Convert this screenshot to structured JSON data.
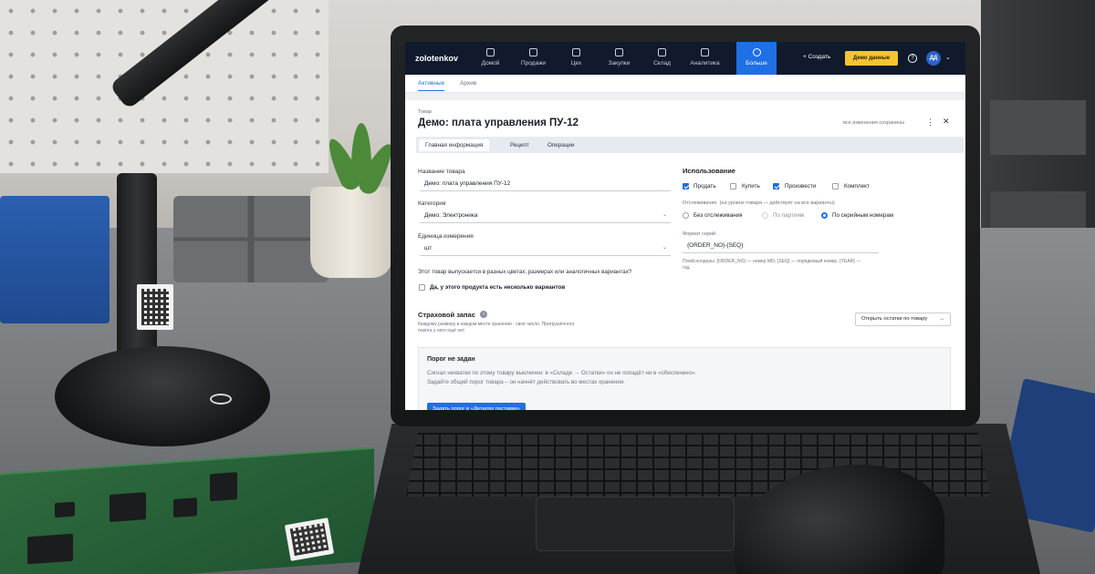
{
  "app": {
    "brand": "zolotenkov",
    "nav": [
      {
        "label": "Домой",
        "icon": "home-icon"
      },
      {
        "label": "Продажи",
        "icon": "cart-icon"
      },
      {
        "label": "Цех",
        "icon": "factory-icon"
      },
      {
        "label": "Закупки",
        "icon": "purchase-icon"
      },
      {
        "label": "Склад",
        "icon": "warehouse-icon"
      },
      {
        "label": "Аналитика",
        "icon": "chart-icon"
      },
      {
        "label": "Больше",
        "icon": "more-circle-icon",
        "active": true
      }
    ],
    "create_label": "+ Создать",
    "demo_label": "Демо данные",
    "help": "?",
    "avatar": "ДД",
    "chevron": "⌄",
    "accent": "#1f6fe5",
    "topbar_color": "#101a2c",
    "demo_color": "#f4c430"
  },
  "subtabs": {
    "active": "Активные",
    "archive": "Архив"
  },
  "product": {
    "kind": "Товар",
    "title": "Демо: плата управления ПУ-12",
    "saved": "все изменения сохранены",
    "tabs": {
      "main": "Главная информация",
      "recipe": "Рецепт",
      "ops": "Операции"
    },
    "name_label": "Название товара",
    "name_value": "Демо: плата управления ПУ-12",
    "category_label": "Категория",
    "category_value": "Демо: Электроника",
    "unit_label": "Единица измерения",
    "unit_value": "шт",
    "variants_question": "Этот товар выпускается в разных цветах, размерах или аналогичных вариантах?",
    "variants_option": "Да, у этого продукта есть несколько вариантов"
  },
  "usage": {
    "title": "Использование",
    "sell": "Продать",
    "buy": "Купить",
    "produce": "Произвести",
    "kit": "Комплект",
    "tracking_label": "Отслеживание",
    "tracking_hint": "(на уровне товара — действует на все варианты)",
    "track_none": "Без отслеживания",
    "track_batch": "По партиям",
    "track_serial": "По серийным номерам",
    "serial_format_label": "Формат серий",
    "serial_format_value": "{ORDER_NO}-{SEQ}",
    "placeholders_hint_1": "Плейсхолдеры: {ORDER_NO} — номер МО, {SEQ} — порядковый номер, {YEAR} —",
    "placeholders_hint_2": "год."
  },
  "safety": {
    "title": "Страховой запас",
    "hint_1": "Каждому размеру в каждом месте хранения - своё число. Пригрушёчного",
    "hint_2": "порога у него ещё нет.",
    "stock_btn": "Открыть остатки по товару",
    "arrow": "→",
    "warn_title": "Порог не задан",
    "warn_text": "Сигнал нехватки по этому товару выключен: в «Складе → Остатки» он не попадёт ни в «обеспечено». Задайте общий порог товара – он начнёт действовать во местах хранения.",
    "set_btn": "Задать порог в «Деталях поставки»"
  }
}
